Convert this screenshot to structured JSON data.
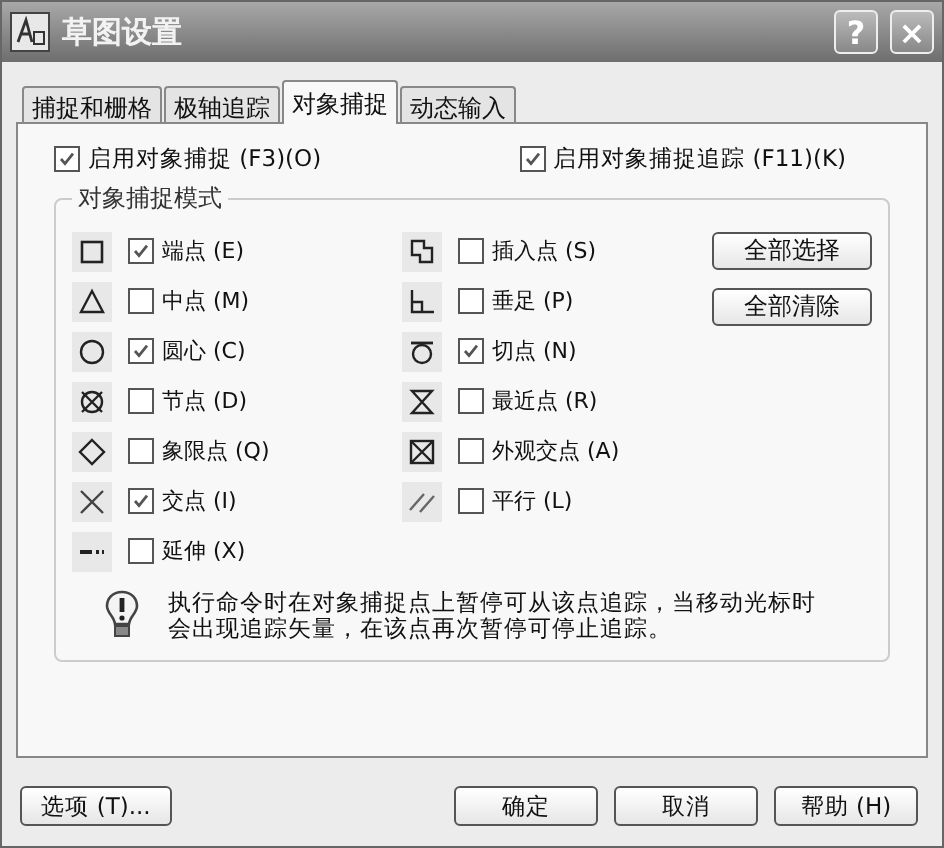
{
  "window": {
    "title": "草图设置",
    "help_button": "?",
    "close_button": "×"
  },
  "tabs": [
    {
      "label": "捕捉和栅格",
      "selected": false
    },
    {
      "label": "极轴追踪",
      "selected": false
    },
    {
      "label": "对象捕捉",
      "selected": true
    },
    {
      "label": "动态输入",
      "selected": false
    }
  ],
  "enable_snap": {
    "label": "启用对象捕捉 (F3)(O)",
    "checked": true
  },
  "enable_tracking": {
    "label": "启用对象捕捉追踪 (F11)(K)",
    "checked": true
  },
  "snap_modes": {
    "title": "对象捕捉模式",
    "left_column": [
      {
        "label": "端点 (E)",
        "checked": true
      },
      {
        "label": "中点 (M)",
        "checked": false
      },
      {
        "label": "圆心 (C)",
        "checked": true
      },
      {
        "label": "节点 (D)",
        "checked": false
      },
      {
        "label": "象限点 (Q)",
        "checked": false
      },
      {
        "label": "交点 (I)",
        "checked": true
      },
      {
        "label": "延伸 (X)",
        "checked": false
      }
    ],
    "right_column": [
      {
        "label": "插入点 (S)",
        "checked": false
      },
      {
        "label": "垂足 (P)",
        "checked": false
      },
      {
        "label": "切点 (N)",
        "checked": true
      },
      {
        "label": "最近点 (R)",
        "checked": false
      },
      {
        "label": "外观交点 (A)",
        "checked": false
      },
      {
        "label": "平行 (L)",
        "checked": false
      }
    ],
    "buttons": [
      "全部选择",
      "全部清除"
    ],
    "note": "执行命令时在对象捕捉点上暂停可从该点追踪，当移动光标时会出现追踪矢量，在该点再次暂停可停止追踪。"
  },
  "footer_buttons": [
    {
      "label": "选项 (T)..."
    },
    {
      "label": "确定"
    },
    {
      "label": "取消"
    },
    {
      "label": "帮助 (H)"
    }
  ]
}
